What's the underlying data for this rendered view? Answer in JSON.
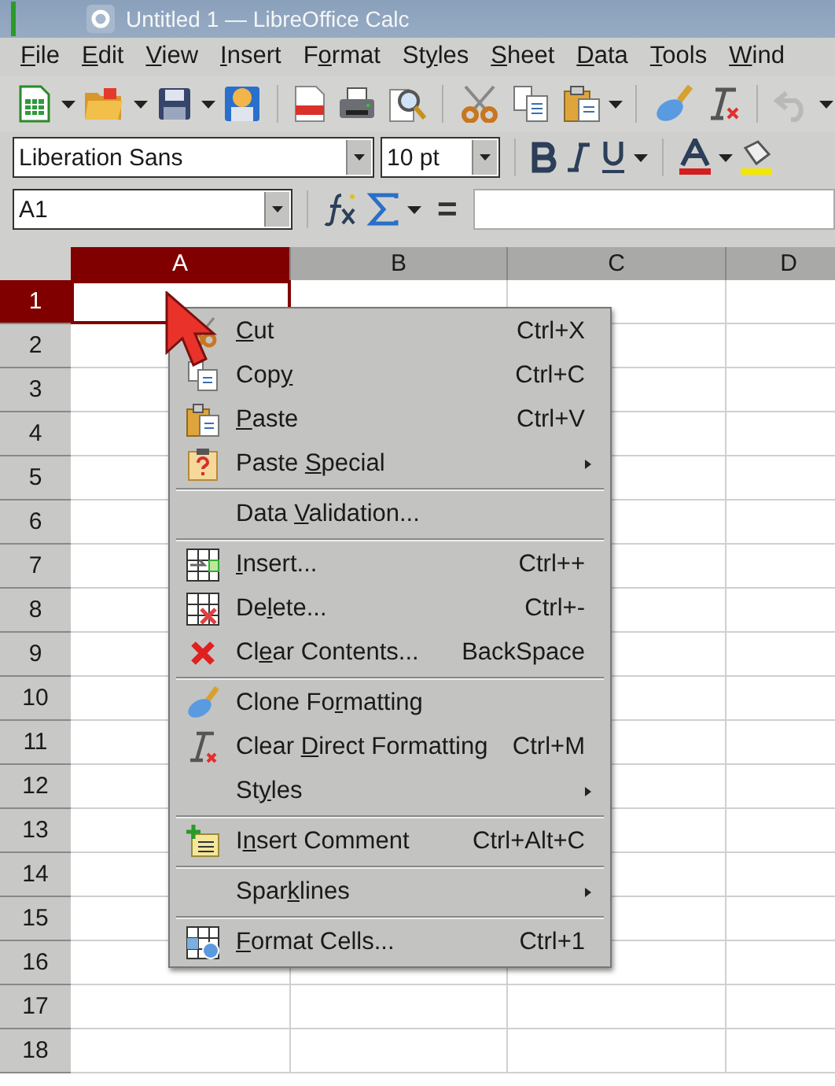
{
  "window": {
    "title": "Untitled 1 — LibreOffice Calc"
  },
  "menubar": [
    {
      "key": "F",
      "post": "ile"
    },
    {
      "key": "E",
      "post": "dit"
    },
    {
      "key": "V",
      "post": "iew"
    },
    {
      "key": "I",
      "post": "nsert"
    },
    {
      "pre": "F",
      "key": "o",
      "post": "rmat"
    },
    {
      "pre": "St",
      "key": "y",
      "post": "les"
    },
    {
      "key": "S",
      "post": "heet"
    },
    {
      "key": "D",
      "post": "ata"
    },
    {
      "key": "T",
      "post": "ools"
    },
    {
      "key": "W",
      "post": "ind"
    }
  ],
  "standard_toolbar": [
    {
      "dropdown": true,
      "disabled": false
    },
    {
      "dropdown": true,
      "disabled": false
    },
    {
      "dropdown": true,
      "disabled": false
    },
    {
      "dropdown": false,
      "disabled": false
    },
    {
      "dropdown": false,
      "disabled": false
    },
    {
      "dropdown": false,
      "disabled": false
    },
    {
      "dropdown": false,
      "disabled": false
    },
    {
      "dropdown": false,
      "disabled": false
    },
    {
      "dropdown": false,
      "disabled": false
    },
    {
      "dropdown": true,
      "disabled": false
    },
    {
      "dropdown": false,
      "disabled": false
    },
    {
      "dropdown": false,
      "disabled": false
    },
    {
      "dropdown": true,
      "disabled": true
    }
  ],
  "formatting_toolbar": {
    "font_name": "Liberation Sans",
    "font_size": "10 pt"
  },
  "formula_bar": {
    "name_box": "A1",
    "operator": "="
  },
  "columns": [
    {
      "label": "A",
      "selected": true
    },
    {
      "label": "B",
      "selected": false
    },
    {
      "label": "C",
      "selected": false
    },
    {
      "label": "D",
      "selected": false
    }
  ],
  "rows": [
    {
      "label": "1",
      "selected": true
    },
    {
      "label": "2",
      "selected": false
    },
    {
      "label": "3",
      "selected": false
    },
    {
      "label": "4",
      "selected": false
    },
    {
      "label": "5",
      "selected": false
    },
    {
      "label": "6",
      "selected": false
    },
    {
      "label": "7",
      "selected": false
    },
    {
      "label": "8",
      "selected": false
    },
    {
      "label": "9",
      "selected": false
    },
    {
      "label": "10",
      "selected": false
    },
    {
      "label": "11",
      "selected": false
    },
    {
      "label": "12",
      "selected": false
    },
    {
      "label": "13",
      "selected": false
    },
    {
      "label": "14",
      "selected": false
    },
    {
      "label": "15",
      "selected": false
    },
    {
      "label": "16",
      "selected": false
    },
    {
      "label": "17",
      "selected": false
    },
    {
      "label": "18",
      "selected": false
    }
  ],
  "context_menu": [
    {
      "kind": "item",
      "key": "C",
      "post": "ut",
      "shortcut": "Ctrl+X",
      "submenu": false
    },
    {
      "kind": "item",
      "pre": "Cop",
      "key": "y",
      "shortcut": "Ctrl+C",
      "submenu": false
    },
    {
      "kind": "item",
      "key": "P",
      "post": "aste",
      "shortcut": "Ctrl+V",
      "submenu": false
    },
    {
      "kind": "item",
      "pre": "Paste ",
      "key": "S",
      "post": "pecial",
      "submenu": true
    },
    {
      "kind": "separator"
    },
    {
      "kind": "item",
      "pre": "Data ",
      "key": "V",
      "post": "alidation...",
      "submenu": false
    },
    {
      "kind": "separator"
    },
    {
      "kind": "item",
      "key": "I",
      "post": "nsert...",
      "shortcut": "Ctrl++",
      "submenu": false
    },
    {
      "kind": "item",
      "pre": "De",
      "key": "l",
      "post": "ete...",
      "shortcut": "Ctrl+-",
      "submenu": false
    },
    {
      "kind": "item",
      "pre": "Cl",
      "key": "e",
      "post": "ar Contents...",
      "shortcut": "BackSpace",
      "submenu": false
    },
    {
      "kind": "separator"
    },
    {
      "kind": "item",
      "pre": "Clone Fo",
      "key": "r",
      "post": "matting",
      "submenu": false
    },
    {
      "kind": "item",
      "pre": "Clear ",
      "key": "D",
      "post": "irect Formatting",
      "shortcut": "Ctrl+M",
      "submenu": false
    },
    {
      "kind": "item",
      "pre": "St",
      "key": "y",
      "post": "les",
      "submenu": true
    },
    {
      "kind": "separator"
    },
    {
      "kind": "item",
      "pre": "I",
      "key": "n",
      "post": "sert Comment",
      "shortcut": "Ctrl+Alt+C",
      "submenu": false
    },
    {
      "kind": "separator"
    },
    {
      "kind": "item",
      "pre": "Spar",
      "key": "k",
      "post": "lines",
      "submenu": true
    },
    {
      "kind": "separator"
    },
    {
      "kind": "item",
      "key": "F",
      "post": "ormat Cells...",
      "shortcut": "Ctrl+1",
      "submenu": false
    }
  ]
}
